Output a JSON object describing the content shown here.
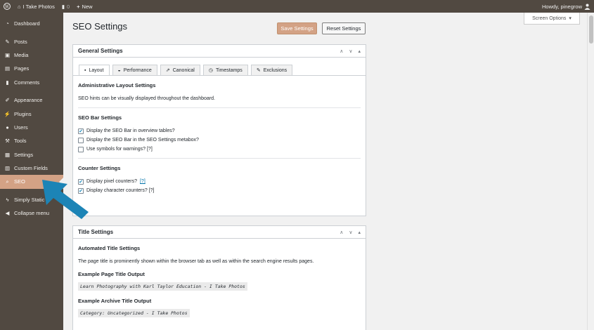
{
  "admin_bar": {
    "site_name": "I Take Photos",
    "comments_count": "0",
    "new_label": "New",
    "howdy": "Howdy, pinegrow"
  },
  "sidebar": {
    "items": [
      {
        "label": "Dashboard",
        "icon": "dashboard-icon"
      },
      {
        "label": "Posts",
        "icon": "pin-icon"
      },
      {
        "label": "Media",
        "icon": "media-icon"
      },
      {
        "label": "Pages",
        "icon": "page-icon"
      },
      {
        "label": "Comments",
        "icon": "comment-icon"
      },
      {
        "label": "Appearance",
        "icon": "brush-icon"
      },
      {
        "label": "Plugins",
        "icon": "plug-icon"
      },
      {
        "label": "Users",
        "icon": "user-icon"
      },
      {
        "label": "Tools",
        "icon": "wrench-icon"
      },
      {
        "label": "Settings",
        "icon": "settings-icon"
      },
      {
        "label": "Custom Fields",
        "icon": "table-icon"
      },
      {
        "label": "SEO",
        "icon": "search-icon"
      },
      {
        "label": "Simply Static",
        "icon": "bolt-icon"
      },
      {
        "label": "Collapse menu",
        "icon": "collapse-icon"
      }
    ]
  },
  "header": {
    "title": "SEO Settings",
    "save_label": "Save Settings",
    "reset_label": "Reset Settings",
    "screen_options": "Screen Options"
  },
  "general": {
    "title": "General Settings",
    "tabs": [
      "Layout",
      "Performance",
      "Canonical",
      "Timestamps",
      "Exclusions"
    ],
    "admin_layout_h": "Administrative Layout Settings",
    "admin_layout_txt": "SEO hints can be visually displayed throughout the dashboard.",
    "seo_bar_h": "SEO Bar Settings",
    "cb1": "Display the SEO Bar in overview tables?",
    "cb2": "Display the SEO Bar in the SEO Settings metabox?",
    "cb3": "Use symbols for warnings? [?]",
    "counter_h": "Counter Settings",
    "cb4": "Display pixel counters?",
    "cb4_link": "[?]",
    "cb5": "Display character counters? [?]"
  },
  "title_settings": {
    "title": "Title Settings",
    "auto_h": "Automated Title Settings",
    "auto_txt": "The page title is prominently shown within the browser tab as well as within the search engine results pages.",
    "page_ex_h": "Example Page Title Output",
    "page_ex": "Learn Photography with Karl Taylor Education - I Take Photos",
    "archive_ex_h": "Example Archive Title Output",
    "archive_ex": "Category: Uncategorized - I Take Photos"
  }
}
